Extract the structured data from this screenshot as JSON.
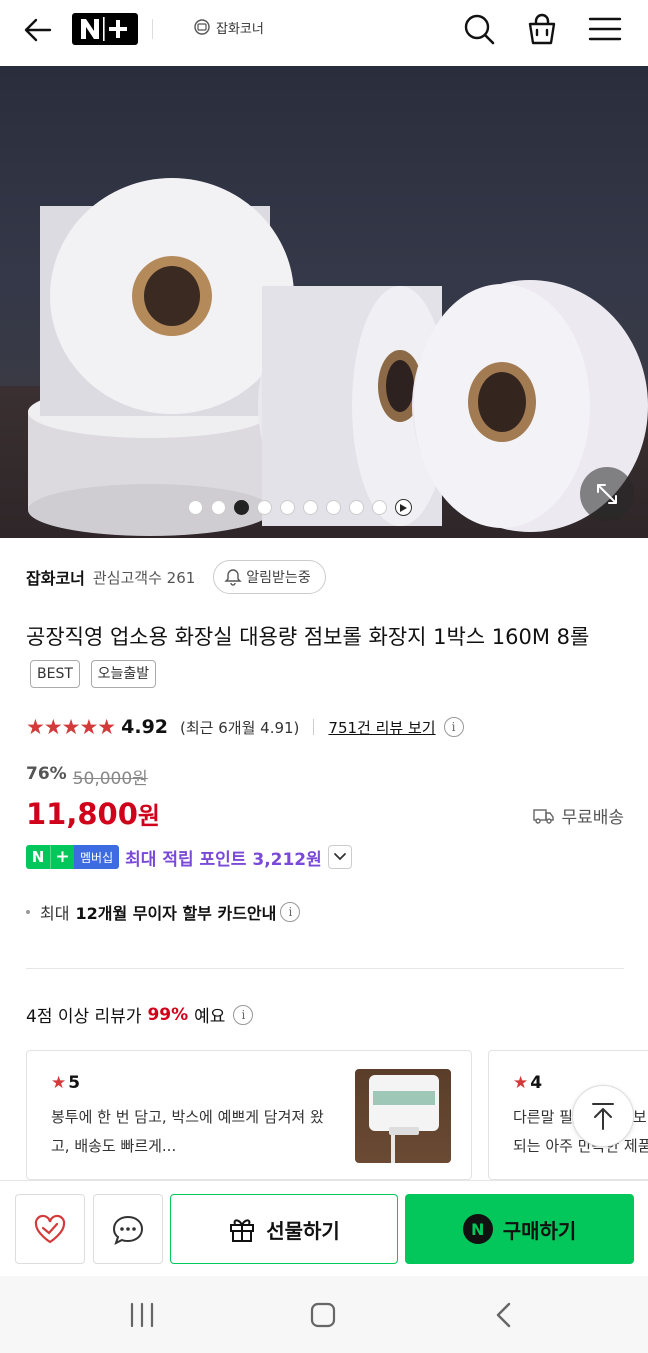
{
  "header": {
    "logo_text": "N+",
    "store_chip": "잡화코너"
  },
  "hero": {
    "slide_count": 10,
    "active_slide": 3
  },
  "store": {
    "name": "잡화코너",
    "interest_label": "관심고객수 261",
    "alarm_label": "알림받는중"
  },
  "product": {
    "title": "공장직영 업소용 화장실 대용량 점보롤 화장지 1박스 160M 8롤",
    "badges": [
      "BEST",
      "오늘출발"
    ]
  },
  "rating": {
    "stars": "★★★★★",
    "score": "4.92",
    "recent": "(최근 6개월 4.91)",
    "review_link": "751건 리뷰 보기"
  },
  "price": {
    "discount": "76%",
    "original": "50,000원",
    "amount": "11,800",
    "won": "원",
    "shipping": "무료배송"
  },
  "membership": {
    "badge_n": "N",
    "badge_plus": "+",
    "badge_text": "멤버십",
    "text": "최대 적립 포인트 3,212원"
  },
  "card_info": {
    "prefix": "최대",
    "bold": "12개월 무이자 할부 카드안내"
  },
  "review_summary": {
    "prefix": "4점 이상 리뷰가",
    "percent": "99%",
    "suffix": "예요"
  },
  "reviews": [
    {
      "rating": "5",
      "text": "봉투에 한 번 담고, 박스에 예쁘게 담겨져 왔고, 배송도 빠르게..."
    },
    {
      "rating": "4",
      "text": "다른말 필요없이 써보니 되는 아주 만족한 제품"
    }
  ],
  "bottom_bar": {
    "gift_label": "선물하기",
    "buy_label": "구매하기",
    "buy_icon": "N"
  },
  "colors": {
    "naver_green": "#03c75a",
    "price_red": "#d0021b",
    "member_purple": "#7a49d8"
  }
}
